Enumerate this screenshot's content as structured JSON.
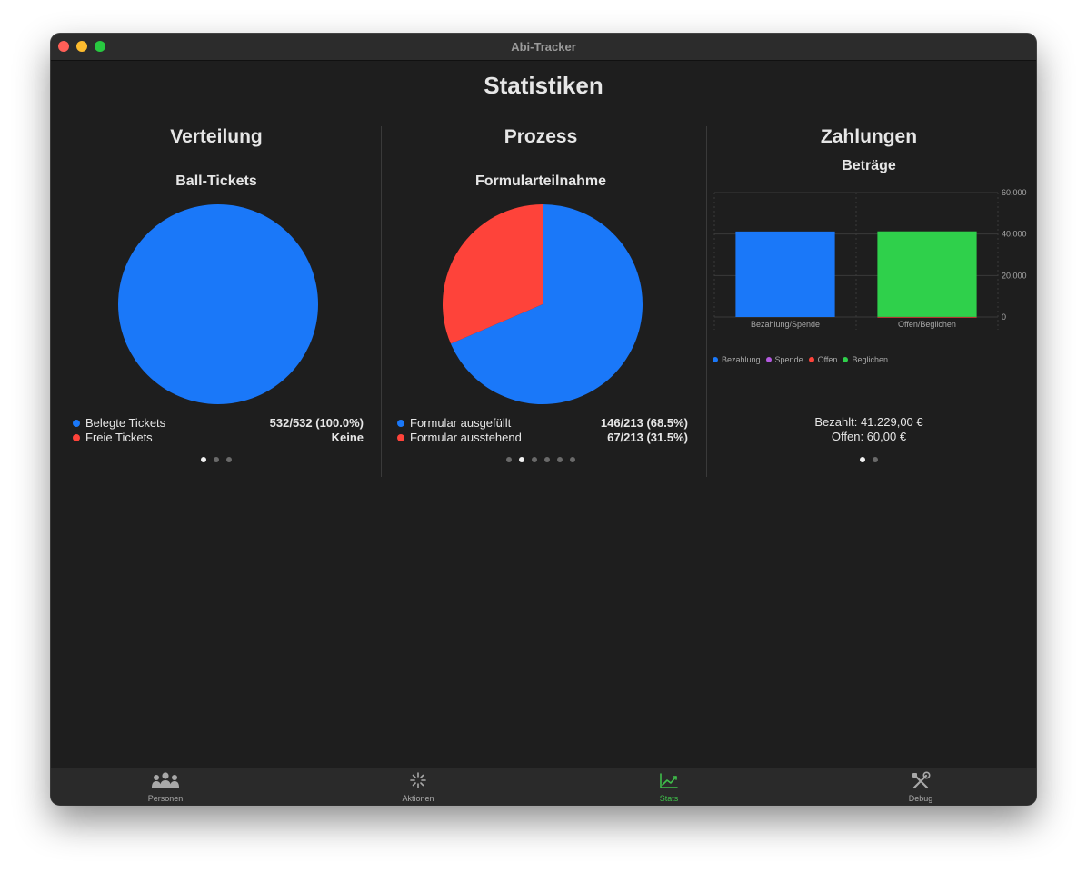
{
  "window": {
    "title": "Abi-Tracker"
  },
  "page": {
    "title": "Statistiken"
  },
  "sections": {
    "verteilung": {
      "title": "Verteilung",
      "chart_title": "Ball-Tickets",
      "legend": [
        {
          "label": "Belegte Tickets",
          "value": "532/532 (100.0%)",
          "color": "#1a78f9"
        },
        {
          "label": "Freie Tickets",
          "value": "Keine",
          "color": "#fe433a"
        }
      ],
      "pages": 3,
      "active_page": 0
    },
    "prozess": {
      "title": "Prozess",
      "chart_title": "Formularteilnahme",
      "legend": [
        {
          "label": "Formular ausgefüllt",
          "value": "146/213 (68.5%)",
          "color": "#1a78f9"
        },
        {
          "label": "Formular ausstehend",
          "value": "67/213 (31.5%)",
          "color": "#fe433a"
        }
      ],
      "pages": 6,
      "active_page": 1
    },
    "zahlungen": {
      "title": "Zahlungen",
      "chart_title": "Beträge",
      "legend": [
        {
          "label": "Bezahlung",
          "color": "#1a78f9"
        },
        {
          "label": "Spende",
          "color": "#b45ae0"
        },
        {
          "label": "Offen",
          "color": "#fe433a"
        },
        {
          "label": "Beglichen",
          "color": "#2fd04b"
        }
      ],
      "totals": {
        "bezahlt": "Bezahlt: 41.229,00 €",
        "offen": "Offen: 60,00 €"
      },
      "pages": 2,
      "active_page": 0
    }
  },
  "chart_data": [
    {
      "type": "pie",
      "title": "Ball-Tickets",
      "categories": [
        "Belegte Tickets",
        "Freie Tickets"
      ],
      "values": [
        532,
        0
      ],
      "colors": [
        "#1a78f9",
        "#fe433a"
      ]
    },
    {
      "type": "pie",
      "title": "Formularteilnahme",
      "categories": [
        "Formular ausgefüllt",
        "Formular ausstehend"
      ],
      "values": [
        146,
        67
      ],
      "colors": [
        "#1a78f9",
        "#fe433a"
      ]
    },
    {
      "type": "bar",
      "title": "Beträge",
      "categories": [
        "Bezahlung/Spende",
        "Offen/Beglichen"
      ],
      "series": [
        {
          "name": "Bezahlung",
          "values": [
            41229,
            0
          ],
          "color": "#1a78f9"
        },
        {
          "name": "Spende",
          "values": [
            0,
            0
          ],
          "color": "#b45ae0"
        },
        {
          "name": "Offen",
          "values": [
            0,
            60
          ],
          "color": "#fe433a"
        },
        {
          "name": "Beglichen",
          "values": [
            0,
            41229
          ],
          "color": "#2fd04b"
        }
      ],
      "ylim": [
        0,
        60000
      ],
      "yticks": [
        "0",
        "20.000",
        "40.000",
        "60.000"
      ],
      "ytick_values": [
        0,
        20000,
        40000,
        60000
      ],
      "stacked": true
    }
  ],
  "tabbar": {
    "tabs": [
      {
        "label": "Personen",
        "icon": "people-icon",
        "active": false
      },
      {
        "label": "Aktionen",
        "icon": "sparkle-icon",
        "active": false
      },
      {
        "label": "Stats",
        "icon": "chart-line-icon",
        "active": true
      },
      {
        "label": "Debug",
        "icon": "tools-icon",
        "active": false
      }
    ]
  }
}
